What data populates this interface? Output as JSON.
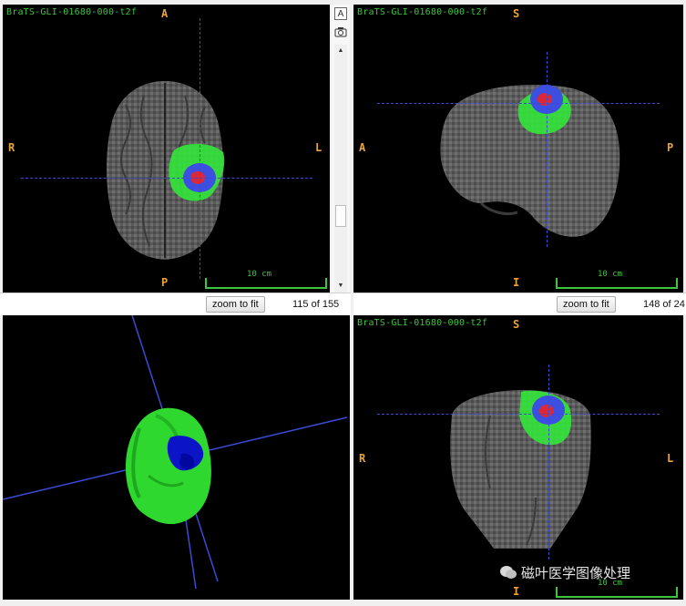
{
  "views": {
    "axial": {
      "title": "BraTS-GLI-01680-000-t2f",
      "orient": {
        "top": "A",
        "bottom": "P",
        "left": "R",
        "right": "L"
      },
      "scale_label": "10 cm",
      "zoom_label": "zoom to fit",
      "slice_text": "115 of 155"
    },
    "sagittal": {
      "title": "BraTS-GLI-01680-000-t2f",
      "orient": {
        "top": "S",
        "bottom": "I",
        "left": "A",
        "right": "P"
      },
      "scale_label": "10 cm",
      "zoom_label": "zoom to fit",
      "slice_text": "148 of 24"
    },
    "coronal": {
      "title": "BraTS-GLI-01680-000-t2f",
      "orient": {
        "top": "S",
        "bottom": "I",
        "left": "R",
        "right": "L"
      },
      "scale_label": "10 cm"
    }
  },
  "sidebar": {
    "annotate_icon": "A",
    "camera_icon": "camera-icon",
    "scroll_up_icon": "▲",
    "scroll_down_icon": "▼"
  },
  "watermark": {
    "text": "磁叶医学图像处理"
  },
  "colors": {
    "label_text": "#3ec43e",
    "orientation": "#e8a43a",
    "crosshair": "#3a4bd6",
    "edema": "#33e63a",
    "enhancing": "#3d4fe0",
    "necrotic": "#d8283a"
  }
}
